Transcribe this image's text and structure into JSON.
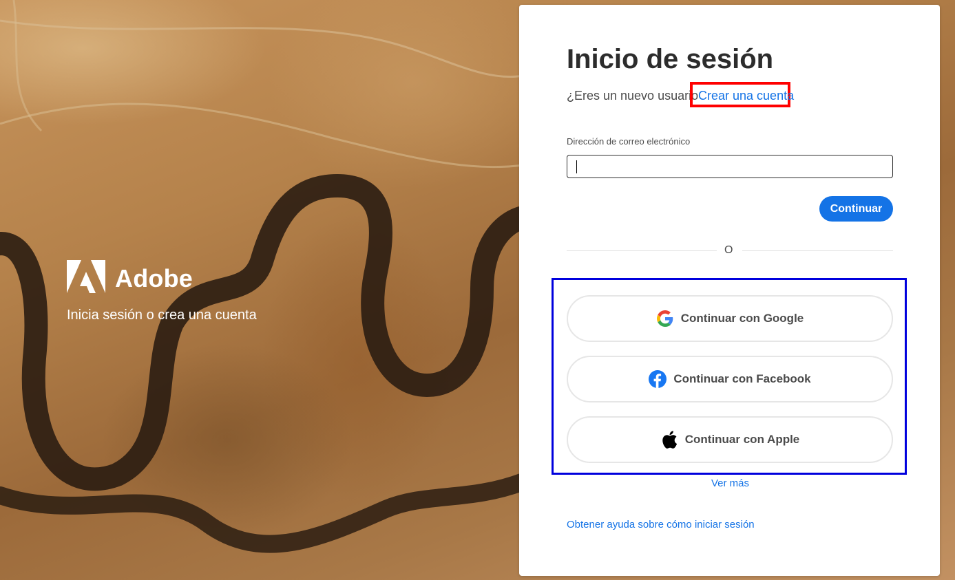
{
  "brand": {
    "name": "Adobe",
    "tagline": "Inicia sesión o crea una cuenta",
    "logo_icon": "adobe-logo-icon"
  },
  "signin": {
    "title": "Inicio de sesión",
    "new_user_prompt": "¿Eres un nuevo usuario",
    "create_account_link": "Crear una cuenta",
    "email_label": "Dirección de correo electrónico",
    "email_value": "",
    "continue_button": "Continuar",
    "divider_text": "O"
  },
  "social": {
    "google_label": "Continuar con Google",
    "facebook_label": "Continuar con Facebook",
    "apple_label": "Continuar con Apple",
    "google_icon": "google-icon",
    "facebook_icon": "facebook-icon",
    "apple_icon": "apple-icon"
  },
  "links": {
    "more": "Ver más",
    "help": "Obtener ayuda sobre cómo iniciar sesión"
  },
  "colors": {
    "accent": "#1473e6",
    "highlight_red": "#ff0000",
    "highlight_blue": "#0000dd",
    "facebook_blue": "#1877f2"
  }
}
